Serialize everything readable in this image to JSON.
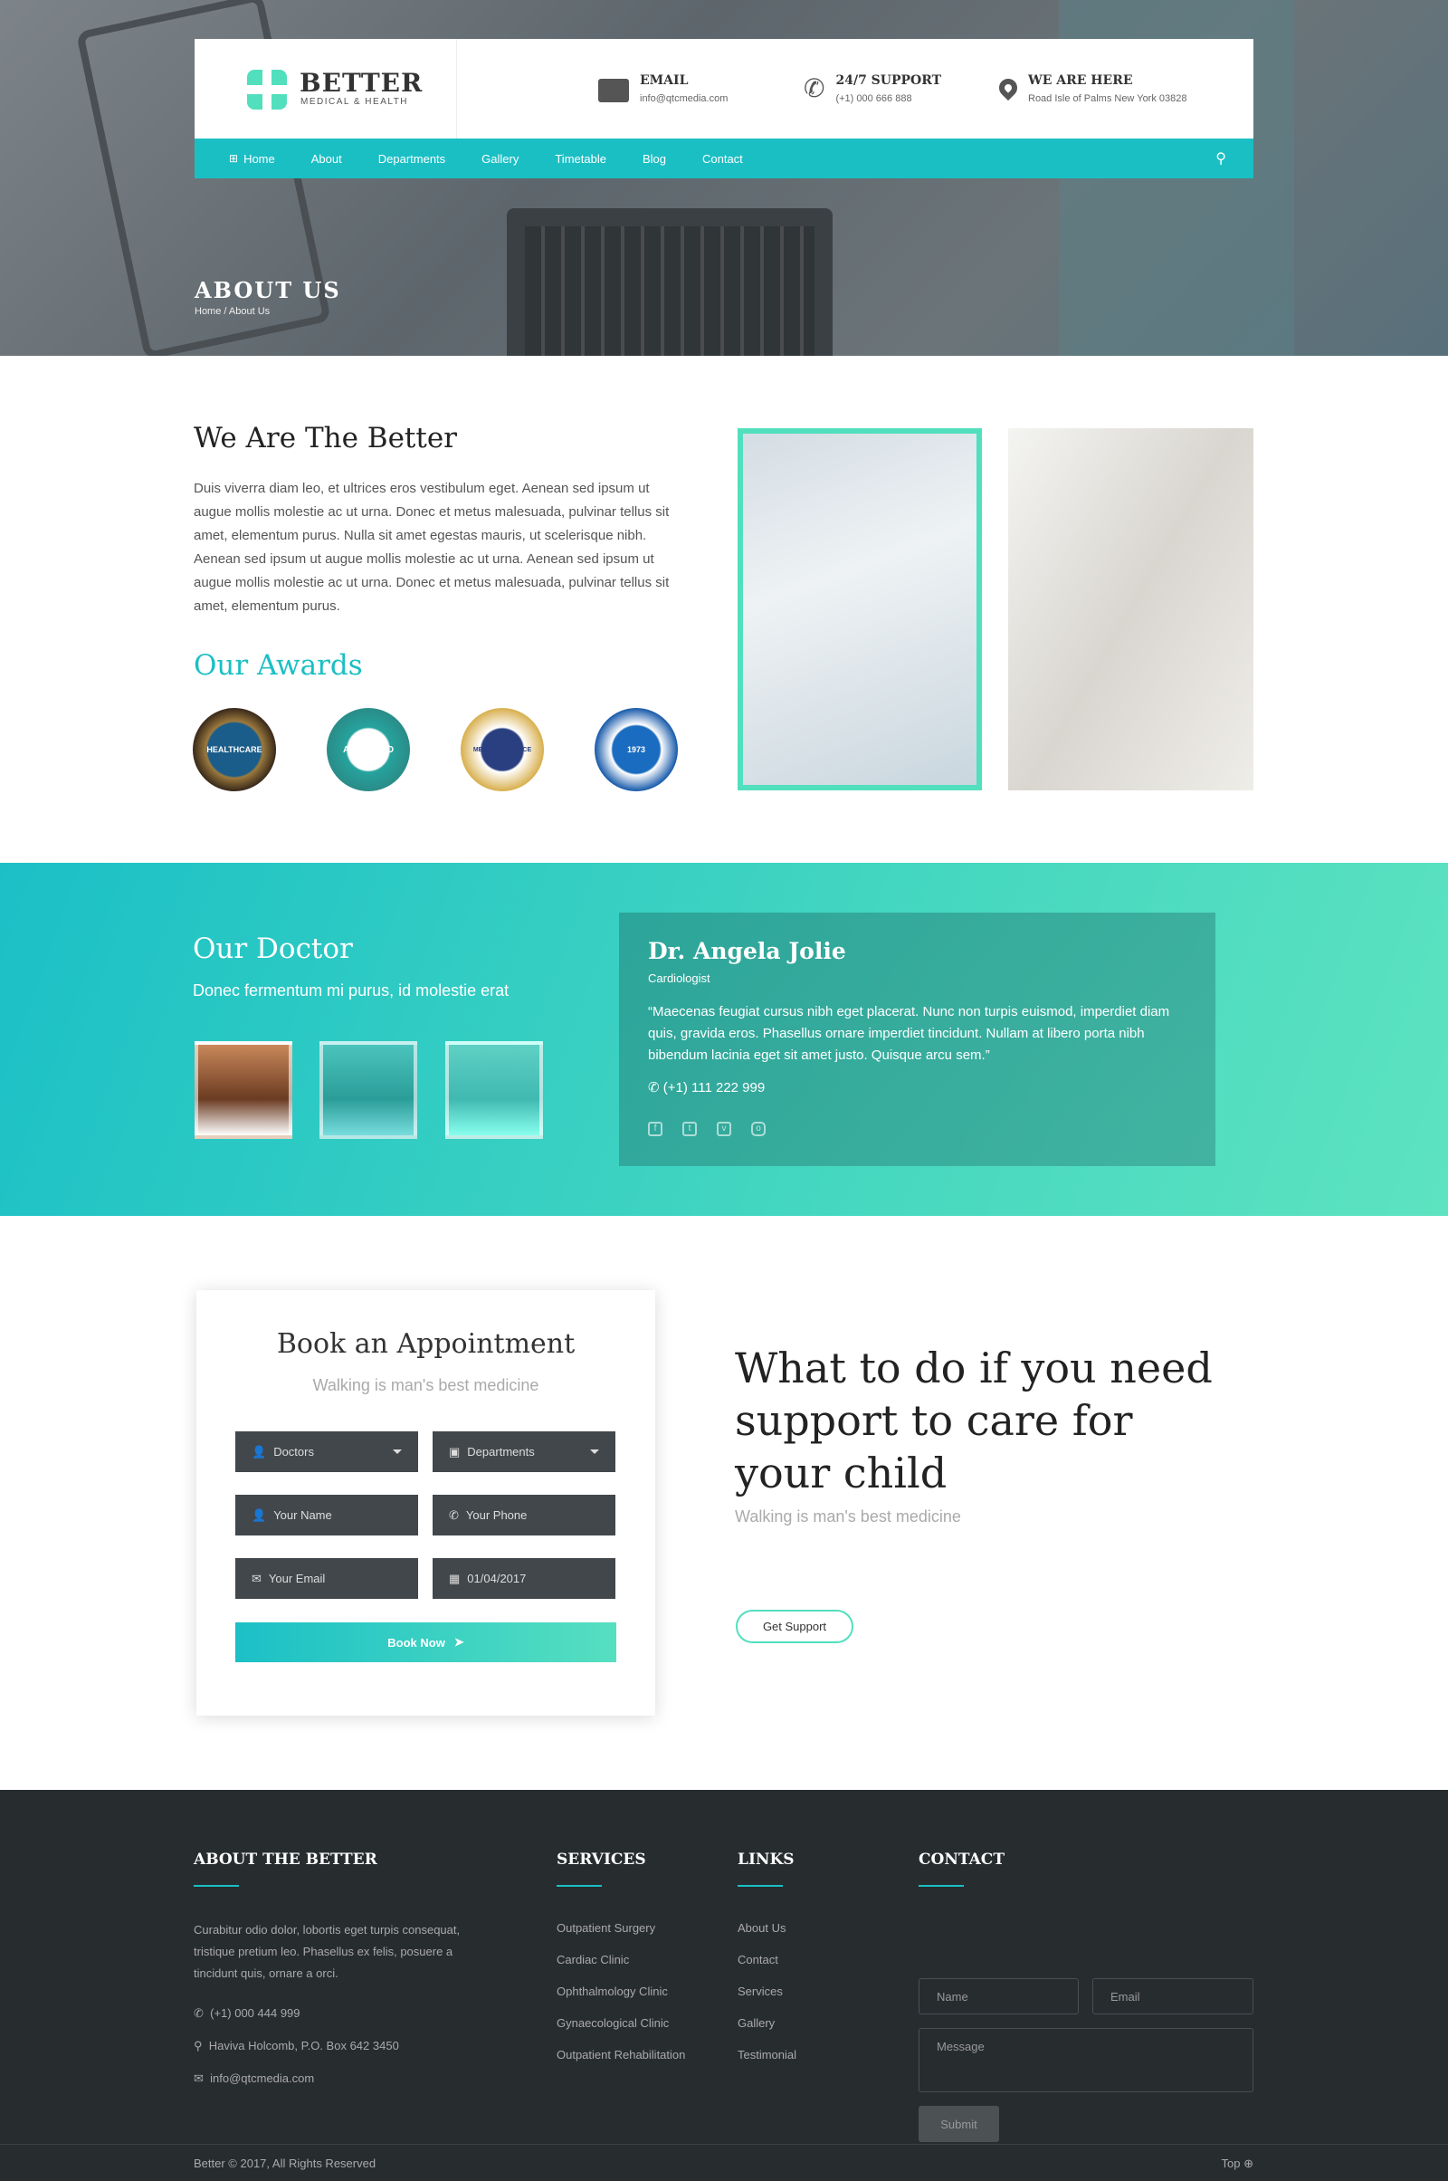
{
  "header": {
    "logo_name": "BETTER",
    "logo_sub": "MEDICAL & HEALTH",
    "email": {
      "title": "EMAIL",
      "value": "info@qtcmedia.com"
    },
    "support": {
      "title": "24/7 SUPPORT",
      "value": "(+1) 000 666 888"
    },
    "location": {
      "title": "WE ARE HERE",
      "value": "Road Isle of Palms New York 03828"
    }
  },
  "nav": [
    "Home",
    "About",
    "Departments",
    "Gallery",
    "Timetable",
    "Blog",
    "Contact"
  ],
  "hero": {
    "title": "ABOUT US",
    "breadcrumb": "Home / About Us"
  },
  "about": {
    "title": "We Are The Better",
    "text": "Duis viverra diam leo, et ultrices eros vestibulum eget. Aenean sed ipsum ut augue mollis molestie ac ut urna. Donec et metus malesuada, pulvinar tellus sit amet, elementum purus. Nulla sit amet egestas mauris, ut scelerisque nibh. Aenean sed ipsum ut augue mollis molestie ac ut urna. Aenean sed ipsum ut augue mollis molestie ac ut urna. Donec et metus malesuada, pulvinar tellus sit amet, elementum purus.",
    "awards_title": "Our Awards",
    "awards": [
      "HEALTHCARE",
      "APPROVED",
      "MEDICAL SERVICE",
      "1973"
    ]
  },
  "doctor": {
    "title": "Our Doctor",
    "subtitle": "Donec fermentum mi purus, id molestie erat",
    "name": "Dr. Angela Jolie",
    "role": "Cardiologist",
    "quote": "“Maecenas feugiat cursus nibh eget placerat. Nunc non turpis euismod, imperdiet diam quis, gravida eros. Phasellus ornare imperdiet tincidunt. Nullam at libero porta nibh bibendum lacinia eget sit amet justo. Quisque arcu sem.”",
    "phone": "(+1) 111 222 999"
  },
  "appointment": {
    "title": "Book an Appointment",
    "subtitle": "Walking is man's best medicine",
    "doctors": "Doctors",
    "departments": "Departments",
    "name": "Your Name",
    "phone": "Your Phone",
    "email": "Your Email",
    "date": "01/04/2017",
    "button": "Book Now"
  },
  "support": {
    "title": "What to do if you need support to care for your child",
    "subtitle": "Walking is man's best medicine",
    "button": "Get Support"
  },
  "footer": {
    "about_title": "ABOUT THE BETTER",
    "about_text": "Curabitur odio dolor, lobortis eget turpis consequat, tristique pretium leo. Phasellus ex felis, posuere a tincidunt quis, ornare a orci.",
    "phone": "(+1) 000 444 999",
    "address": "Haviva Holcomb, P.O. Box 642 3450",
    "email": "info@qtcmedia.com",
    "services_title": "SERVICES",
    "services": [
      "Outpatient Surgery",
      "Cardiac Clinic",
      "Ophthalmology Clinic",
      "Gynaecological Clinic",
      "Outpatient Rehabilitation"
    ],
    "links_title": "LINKS",
    "links": [
      "About Us",
      "Contact",
      "Services",
      "Gallery",
      "Testimonial"
    ],
    "contact_title": "CONTACT",
    "name_ph": "Name",
    "email_ph": "Email",
    "message_ph": "Message",
    "submit": "Submit",
    "copyright": "Better © 2017, All Rights Reserved",
    "top": "Top"
  }
}
